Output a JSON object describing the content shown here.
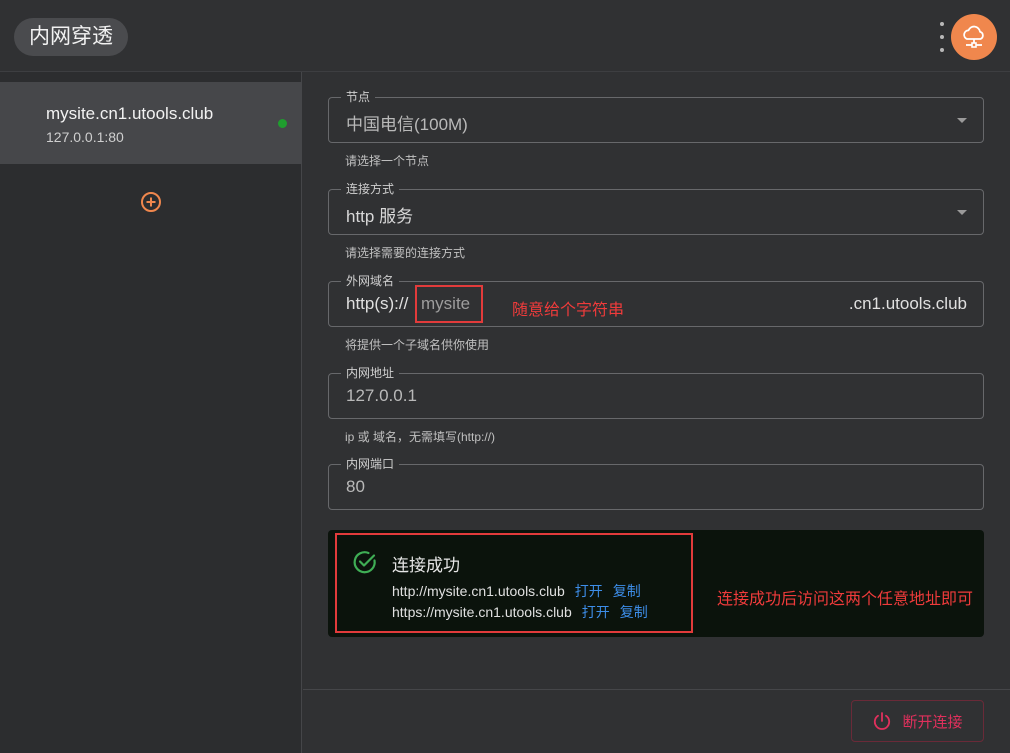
{
  "app": {
    "title": "内网穿透"
  },
  "sidebar": {
    "items": [
      {
        "domain": "mysite.cn1.utools.club",
        "local": "127.0.0.1:80",
        "status_color": "#1f9d2e"
      }
    ],
    "add_icon": "plus-circle-icon"
  },
  "form": {
    "node": {
      "label": "节点",
      "value": "中国电信(100M)",
      "helper": "请选择一个节点"
    },
    "mode": {
      "label": "连接方式",
      "value": "http 服务",
      "helper": "请选择需要的连接方式"
    },
    "domain": {
      "label": "外网域名",
      "prefix": "http(s)://",
      "placeholder": "mysite",
      "suffix": ".cn1.utools.club",
      "helper": "将提供一个子域名供你使用",
      "annotation": "随意给个字符串"
    },
    "host": {
      "label": "内网地址",
      "value": "127.0.0.1",
      "helper": "ip 或 域名，无需填写(http://)"
    },
    "port": {
      "label": "内网端口",
      "value": "80"
    }
  },
  "status": {
    "title": "连接成功",
    "urls": [
      {
        "url": "http://mysite.cn1.utools.club",
        "open": "打开",
        "copy": "复制"
      },
      {
        "url": "https://mysite.cn1.utools.club",
        "open": "打开",
        "copy": "复制"
      }
    ],
    "annotation": "连接成功后访问这两个任意地址即可"
  },
  "footer": {
    "disconnect_label": "断开连接"
  },
  "colors": {
    "accent": "#f0874d",
    "success": "#3fae55",
    "danger": "#e0305c",
    "annotation": "#ef3b3b",
    "link": "#3d8de8"
  }
}
